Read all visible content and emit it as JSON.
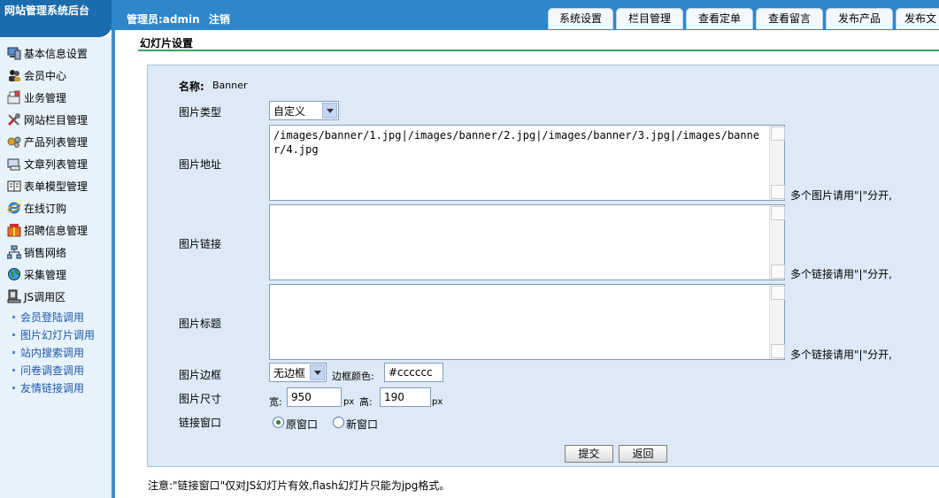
{
  "app": {
    "logo": "网站管理系统后台",
    "admin_label": "管理员:admin",
    "logout": "注销"
  },
  "tabs": [
    "系统设置",
    "栏目管理",
    "查看定单",
    "查看留言",
    "发布产品",
    "发布文"
  ],
  "sidebar": {
    "items": [
      {
        "label": "基本信息设置",
        "icon": "computer-icon"
      },
      {
        "label": "会员中心",
        "icon": "users-icon"
      },
      {
        "label": "业务管理",
        "icon": "briefcase-icon"
      },
      {
        "label": "网站栏目管理",
        "icon": "tools-icon"
      },
      {
        "label": "产品列表管理",
        "icon": "gears-icon"
      },
      {
        "label": "文章列表管理",
        "icon": "document-icon"
      },
      {
        "label": "表单模型管理",
        "icon": "book-icon"
      },
      {
        "label": "在线订购",
        "icon": "ie-icon"
      },
      {
        "label": "招聘信息管理",
        "icon": "gift-icon"
      },
      {
        "label": "销售网络",
        "icon": "network-icon"
      },
      {
        "label": "采集管理",
        "icon": "globe-icon"
      },
      {
        "label": "JS调用区",
        "icon": "monitor-icon"
      }
    ],
    "subitems": [
      "会员登陆调用",
      "图片幻灯片调用",
      "站内搜索调用",
      "问卷调查调用",
      "友情链接调用"
    ]
  },
  "page": {
    "title": "幻灯片设置",
    "name_label": "名称:",
    "name_value": "Banner",
    "type_label": "图片类型",
    "type_value": "自定义",
    "url_label": "图片地址",
    "url_value": "/images/banner/1.jpg|/images/banner/2.jpg|/images/banner/3.jpg|/images/banner/4.jpg",
    "url_hint": "多个图片请用\"|\"分开,",
    "link_label": "图片链接",
    "link_value": "",
    "link_hint": "多个链接请用\"|\"分开,",
    "caption_label": "图片标题",
    "caption_value": "",
    "caption_hint": "多个链接请用\"|\"分开,",
    "border_label": "图片边框",
    "border_value": "无边框",
    "border_color_label": "边框颜色:",
    "border_color_value": "#cccccc",
    "size_label": "图片尺寸",
    "width_label": "宽:",
    "width_value": "950",
    "px1": "px",
    "height_label": "高:",
    "height_value": "190",
    "px2": "px",
    "window_label": "链接窗口",
    "window_self": "原窗口",
    "window_new": "新窗口",
    "submit": "提交",
    "back": "返回",
    "note": "注意:\"链接窗口\"仅对JS幻灯片有效,flash幻灯片只能为jpg格式。"
  },
  "colors": {
    "header": "#2f86c9",
    "sidebar": "#e8f2fb",
    "form_bg": "#dde9f7",
    "title_line": "#3aa062",
    "sublink": "#1d5aa8"
  }
}
